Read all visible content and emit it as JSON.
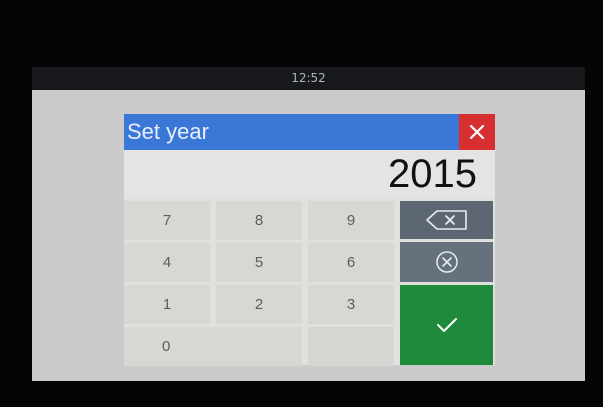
{
  "statusbar": {
    "time": "12:52"
  },
  "dialog": {
    "title": "Set year",
    "value": "2015",
    "keys": {
      "k7": "7",
      "k8": "8",
      "k9": "9",
      "k4": "4",
      "k5": "5",
      "k6": "6",
      "k1": "1",
      "k2": "2",
      "k3": "3",
      "k0": "0"
    },
    "icons": {
      "close": "close-icon",
      "backspace": "backspace-icon",
      "clear": "clear-circle-icon",
      "confirm": "checkmark-icon"
    }
  },
  "colors": {
    "title_bar": "#3b77d7",
    "close_button": "#d72f30",
    "backspace_button": "#5d6773",
    "clear_button": "#65717d",
    "confirm_button": "#1f8a3b"
  }
}
